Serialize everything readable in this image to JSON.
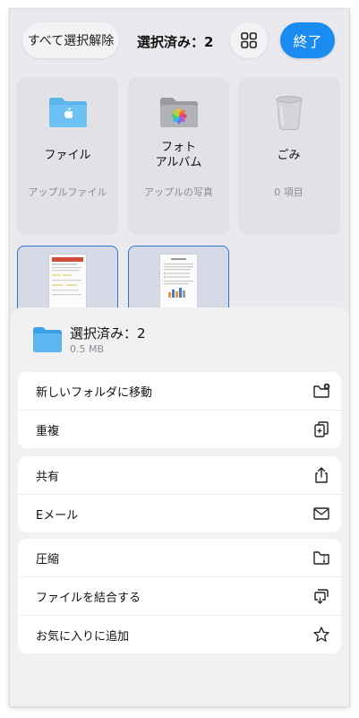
{
  "header": {
    "deselect_all_label": "すべて選択解除",
    "selection_title": "選択済み：2",
    "grid_icon": "grid-icon",
    "done_label": "終了"
  },
  "tiles": [
    {
      "name": "ファイル",
      "subtitle": "アップルファイル",
      "icon": "files-folder-icon"
    },
    {
      "name": "フォト\nアルバム",
      "subtitle": "アップルの写真",
      "icon": "photos-folder-icon"
    },
    {
      "name": "ごみ",
      "subtitle": "0 項目",
      "icon": "trash-icon"
    }
  ],
  "thumbnails": [
    {
      "icon": "document-thumbnail"
    },
    {
      "icon": "document-thumbnail"
    }
  ],
  "sheet": {
    "title": "選択済み：2",
    "size": "0.5 MB",
    "groups": [
      [
        {
          "label": "新しいフォルダに移動",
          "icon": "new-folder-icon"
        },
        {
          "label": "重複",
          "icon": "duplicate-icon"
        }
      ],
      [
        {
          "label": "共有",
          "icon": "share-icon"
        },
        {
          "label": "Eメール",
          "icon": "mail-icon"
        }
      ],
      [
        {
          "label": "圧縮",
          "icon": "zip-icon"
        },
        {
          "label": "ファイルを結合する",
          "icon": "merge-icon"
        },
        {
          "label": "お気に入りに追加",
          "icon": "star-icon"
        }
      ]
    ]
  },
  "colors": {
    "accent": "#1a8bf0",
    "selection_border": "#2f72d8",
    "background": "#e9e9ee"
  }
}
